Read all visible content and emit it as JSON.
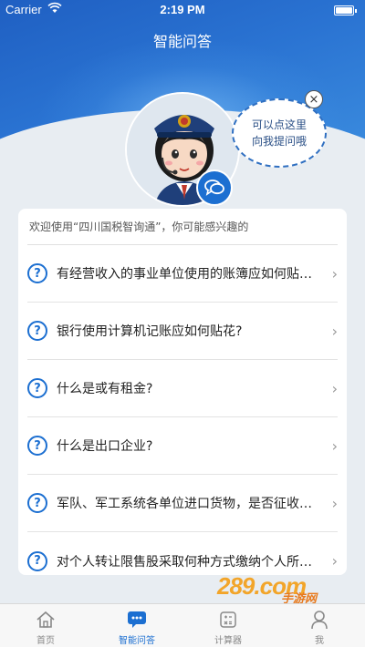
{
  "status_bar": {
    "carrier": "Carrier",
    "time": "2:19 PM"
  },
  "header": {
    "title": "智能问答"
  },
  "assistant": {
    "bubble_line1": "可以点这里",
    "bubble_line2": "向我提问哦",
    "close_symbol": "×"
  },
  "intro_text": "欢迎使用“四川国税智询通”，你可能感兴趣的",
  "questions": [
    {
      "icon": "?",
      "text": "有经营收入的事业单位使用的账簿应如何贴花？"
    },
    {
      "icon": "?",
      "text": "银行使用计算机记账应如何贴花?"
    },
    {
      "icon": "?",
      "text": "什么是或有租金?"
    },
    {
      "icon": "?",
      "text": "什么是出口企业?"
    },
    {
      "icon": "?",
      "text": "军队、军工系统各单位进口货物，是否征收增值税？"
    },
    {
      "icon": "?",
      "text": "对个人转让限售股采取何种方式缴纳个人所得税？"
    }
  ],
  "tabs": [
    {
      "label": "首页",
      "icon": "home-icon",
      "active": false
    },
    {
      "label": "智能问答",
      "icon": "chat-icon",
      "active": true
    },
    {
      "label": "计算器",
      "icon": "calculator-icon",
      "active": false
    },
    {
      "label": "我",
      "icon": "user-icon",
      "active": false
    }
  ],
  "watermark": {
    "main": "289.com",
    "sub": "手游网"
  },
  "colors": {
    "accent": "#1c6fd1",
    "header_blue": "#2a73d2",
    "watermark_orange": "#f2a52a"
  }
}
